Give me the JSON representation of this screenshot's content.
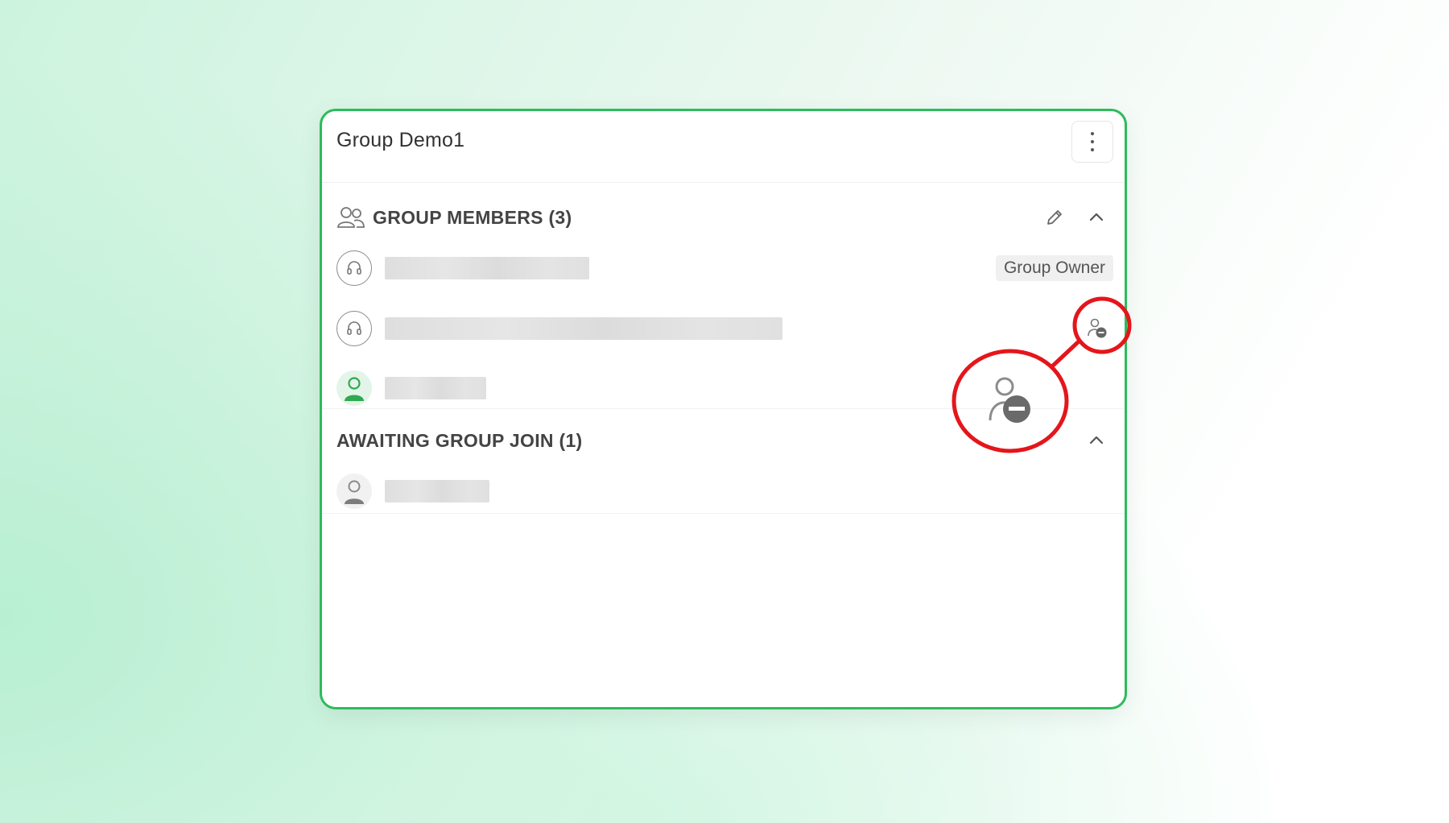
{
  "panel": {
    "title": "Group Demo1",
    "more_icon": "more-vertical-icon"
  },
  "members_section": {
    "label": "GROUP MEMBERS (3)",
    "icon": "users-icon",
    "edit_icon": "pencil-icon",
    "collapse_icon": "chevron-up-icon",
    "owner_badge": "Group Owner",
    "remove_icon": "remove-member-icon"
  },
  "awaiting_section": {
    "label": "AWAITING GROUP JOIN (1)",
    "collapse_icon": "chevron-up-icon"
  },
  "colors": {
    "card_border": "#2dbb5d",
    "annotation": "#e4161b",
    "online_avatar": "#2fa84f"
  }
}
